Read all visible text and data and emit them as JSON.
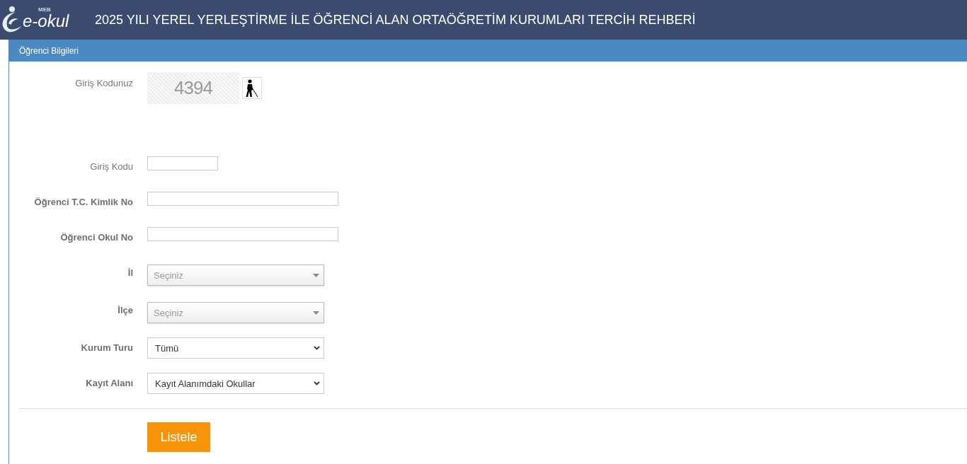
{
  "header": {
    "logo_small": "MEB",
    "logo_text": "e-okul",
    "title": "2025 YILI YEREL YERLEŞTİRME İLE ÖĞRENCİ ALAN ORTAÖĞRETİM KURUMLARI TERCİH REHBERİ"
  },
  "panel": {
    "title": "Öğrenci Bilgileri",
    "captcha": {
      "label": "Giriş Kodunuz",
      "code": "4394"
    },
    "fields": [
      {
        "label": "Giriş Kodu",
        "bold": false,
        "kind": "short-text"
      },
      {
        "label": "Öğrenci T.C. Kimlik No",
        "bold": true,
        "kind": "text"
      },
      {
        "label": "Öğrenci Okul No",
        "bold": true,
        "kind": "text"
      },
      {
        "label": "İl",
        "bold": true,
        "kind": "combo",
        "placeholder": "Seçiniz"
      },
      {
        "label": "İlçe",
        "bold": true,
        "kind": "combo",
        "placeholder": "Seçiniz"
      },
      {
        "label": "Kurum Turu",
        "bold": true,
        "kind": "select",
        "value": "Tümü"
      },
      {
        "label": "Kayıt Alanı",
        "bold": true,
        "kind": "select",
        "value": "Kayıt Alanımdaki Okullar"
      }
    ],
    "button": "Listele"
  }
}
